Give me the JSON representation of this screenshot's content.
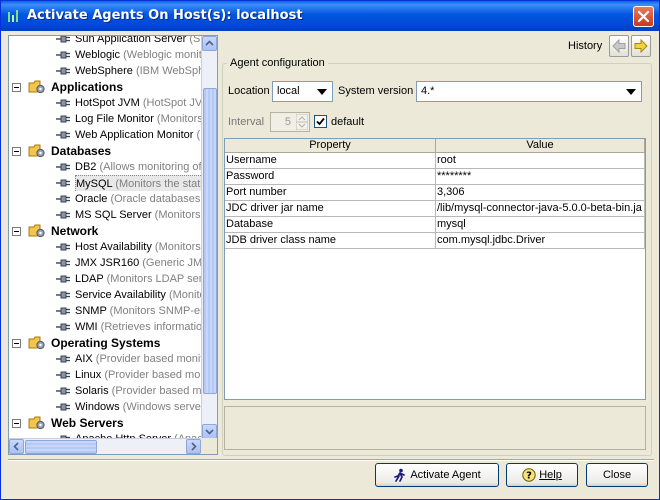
{
  "window": {
    "title": "Activate Agents On Host(s): localhost"
  },
  "tree": {
    "rows": [
      {
        "kind": "leaf",
        "name": "Sun Application Server",
        "desc": " (Sun"
      },
      {
        "kind": "leaf",
        "name": "Weblogic",
        "desc": " (Weblogic monitor"
      },
      {
        "kind": "leaf",
        "name": "WebSphere",
        "desc": " (IBM WebSpher"
      },
      {
        "kind": "cat",
        "name": "Applications"
      },
      {
        "kind": "leaf",
        "name": "HotSpot JVM",
        "desc": " (HotSpot JVM"
      },
      {
        "kind": "leaf",
        "name": "Log File Monitor",
        "desc": " (Monitors a"
      },
      {
        "kind": "leaf",
        "name": "Web Application Monitor",
        "desc": " (M"
      },
      {
        "kind": "cat",
        "name": "Databases"
      },
      {
        "kind": "leaf",
        "name": "DB2",
        "desc": " (Allows monitoring of D"
      },
      {
        "kind": "leaf",
        "name": "MySQL",
        "desc": " (Monitors the status",
        "selected": true
      },
      {
        "kind": "leaf",
        "name": "Oracle",
        "desc": " (Oracle databases m"
      },
      {
        "kind": "leaf",
        "name": "MS SQL Server",
        "desc": " (Monitors MS"
      },
      {
        "kind": "cat",
        "name": "Network"
      },
      {
        "kind": "leaf",
        "name": "Host Availability",
        "desc": " (Monitors a"
      },
      {
        "kind": "leaf",
        "name": "JMX JSR160",
        "desc": " (Generic JMX JS"
      },
      {
        "kind": "leaf",
        "name": "LDAP",
        "desc": " (Monitors LDAP server"
      },
      {
        "kind": "leaf",
        "name": "Service Availability",
        "desc": " (Monitor"
      },
      {
        "kind": "leaf",
        "name": "SNMP",
        "desc": " (Monitors SNMP-enab"
      },
      {
        "kind": "leaf",
        "name": "WMI",
        "desc": " (Retrieves information"
      },
      {
        "kind": "cat",
        "name": "Operating Systems"
      },
      {
        "kind": "leaf",
        "name": "AIX",
        "desc": " (Provider based monitor"
      },
      {
        "kind": "leaf",
        "name": "Linux",
        "desc": " (Provider based monit"
      },
      {
        "kind": "leaf",
        "name": "Solaris",
        "desc": " (Provider based mon"
      },
      {
        "kind": "leaf",
        "name": "Windows",
        "desc": " (Windows servers"
      },
      {
        "kind": "cat",
        "name": "Web Servers"
      },
      {
        "kind": "leaf",
        "name": "Apache Http Server",
        "desc": " (Apach"
      }
    ]
  },
  "history": {
    "label": "History"
  },
  "config": {
    "group_title": "Agent configuration",
    "location_label": "Location",
    "location_value": "local",
    "version_label": "System version",
    "version_value": "4.*",
    "interval_label": "Interval",
    "interval_value": "5",
    "default_label": "default",
    "table": {
      "headers": [
        "Property",
        "Value"
      ],
      "rows": [
        [
          "Username",
          "root"
        ],
        [
          "Password",
          "********"
        ],
        [
          "Port number",
          "3,306"
        ],
        [
          "JDC driver jar name",
          "/lib/mysql-connector-java-5.0.0-beta-bin.ja"
        ],
        [
          "Database",
          "mysql"
        ],
        [
          "JDB driver class name",
          "com.mysql.jdbc.Driver"
        ]
      ]
    }
  },
  "buttons": {
    "activate": "Activate Agent",
    "help": "Help",
    "close": "Close"
  },
  "colors": {
    "title_bar": "#0054e3",
    "dialog_bg": "#ece9d8",
    "tree_desc": "#808080"
  }
}
